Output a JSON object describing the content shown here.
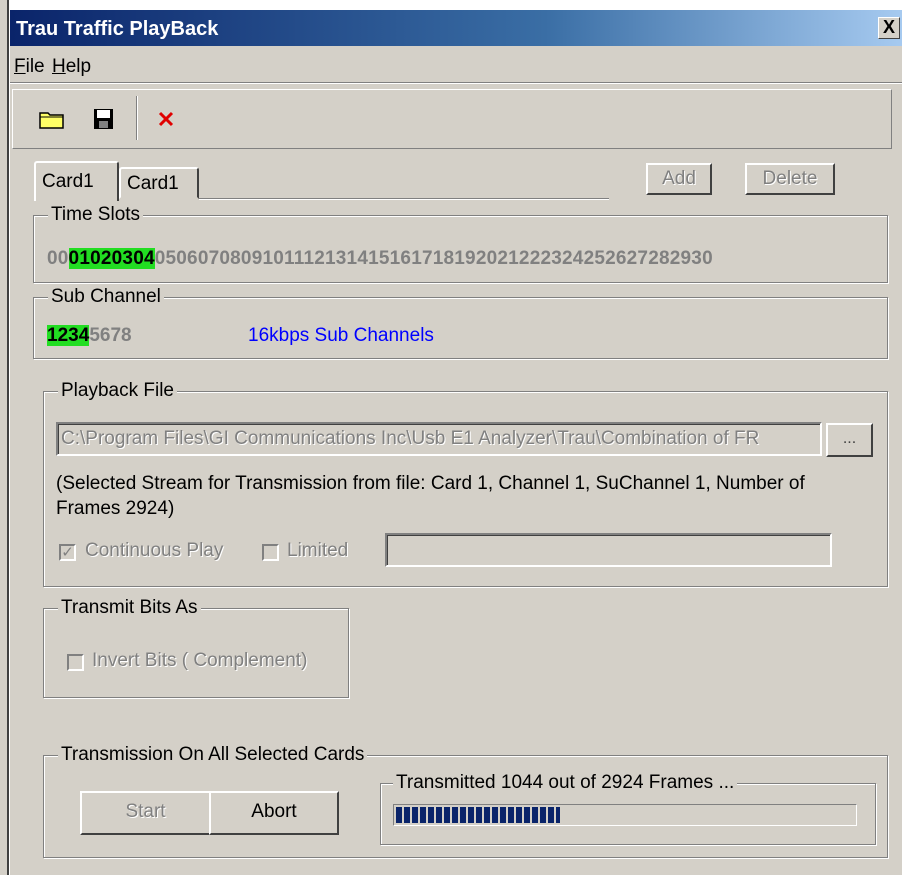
{
  "window": {
    "title": "Trau Traffic PlayBack",
    "close_symbol": "X"
  },
  "menu": {
    "items": [
      {
        "label": "File",
        "accel": "F"
      },
      {
        "label": "Help",
        "accel": "H"
      }
    ]
  },
  "toolbar": {
    "icons": [
      "open-folder-icon",
      "save-disk-icon",
      "delete-x-icon"
    ]
  },
  "tabs": [
    {
      "label": "Card1",
      "selected": true
    },
    {
      "label": "Card1",
      "selected": false
    }
  ],
  "buttons": {
    "add": "Add",
    "delete": "Delete",
    "start": "Start",
    "abort": "Abort",
    "browse": "..."
  },
  "time_slots": {
    "label": "Time Slots",
    "slots": [
      "00",
      "01",
      "02",
      "03",
      "04",
      "05",
      "06",
      "07",
      "08",
      "09",
      "10",
      "11",
      "12",
      "13",
      "14",
      "15",
      "16",
      "17",
      "18",
      "19",
      "20",
      "21",
      "22",
      "23",
      "24",
      "25",
      "26",
      "27",
      "28",
      "29",
      "30"
    ],
    "selected": [
      "01",
      "02",
      "03",
      "04"
    ]
  },
  "sub_channel": {
    "label": "Sub Channel",
    "channels": [
      "1",
      "2",
      "3",
      "4",
      "5",
      "6",
      "7",
      "8"
    ],
    "selected": [
      "1",
      "2",
      "3",
      "4"
    ],
    "rate_label": "16kbps Sub Channels"
  },
  "playback": {
    "label": "Playback File",
    "path": "C:\\Program Files\\GI Communications Inc\\Usb E1 Analyzer\\Trau\\Combination of FR",
    "info": "(Selected Stream for Transmission from file: Card 1, Channel 1, SuChannel 1, Number of Frames 2924)",
    "continuous_label": "Continuous Play",
    "continuous_checked": true,
    "limited_label": "Limited",
    "limited_checked": false,
    "limited_value": ""
  },
  "transmit_bits": {
    "label": "Transmit Bits As",
    "invert_label": "Invert Bits ( Complement)",
    "invert_checked": false
  },
  "transmission": {
    "label": "Transmission On All Selected Cards",
    "status": "Transmitted 1044 out of 2924 Frames ...",
    "progress_fraction": 0.357
  },
  "colors": {
    "title_start": "#0a246a",
    "title_end": "#a6caf0",
    "selected_green": "#22dd22",
    "face": "#d4d0c8",
    "rate_blue": "#0000ff"
  }
}
